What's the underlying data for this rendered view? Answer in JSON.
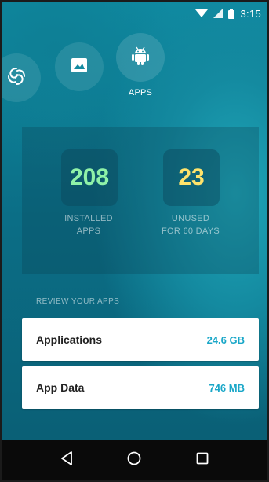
{
  "status_bar": {
    "time": "3:15",
    "icons": [
      "wifi-icon",
      "signal-icon",
      "battery-icon"
    ]
  },
  "top_nav": {
    "items": [
      {
        "icon": "swirl-icon",
        "label": ""
      },
      {
        "icon": "image-icon",
        "label": ""
      },
      {
        "icon": "android-icon",
        "label": "APPS"
      }
    ]
  },
  "stats": {
    "installed": {
      "value": "208",
      "line1": "INSTALLED",
      "line2": "APPS",
      "color": "#8ff2a8"
    },
    "unused": {
      "value": "23",
      "line1": "UNUSED",
      "line2": "FOR 60 DAYS",
      "color": "#ffe36b"
    }
  },
  "review": {
    "label": "REVIEW YOUR APPS",
    "items": [
      {
        "title": "Applications",
        "size": "24.6 GB"
      },
      {
        "title": "App Data",
        "size": "746 MB"
      }
    ]
  },
  "navbar": {
    "buttons": [
      "back-icon",
      "home-icon",
      "recents-icon"
    ]
  },
  "colors": {
    "accent": "#1aa7c8",
    "background": "#0b6e86"
  }
}
